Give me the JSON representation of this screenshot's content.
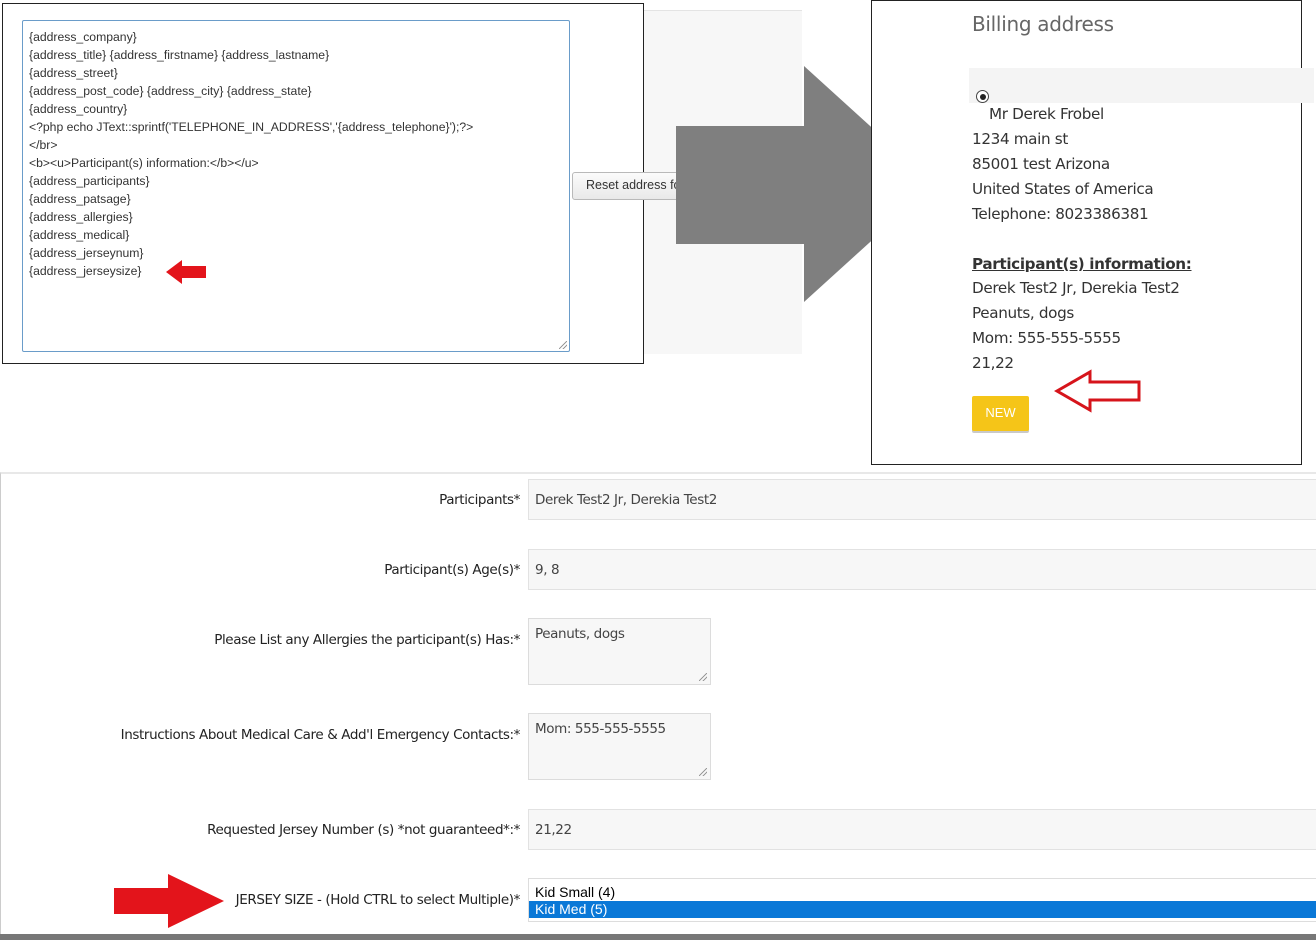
{
  "editor": {
    "template_lines": [
      "{address_company}",
      "{address_title} {address_firstname} {address_lastname}",
      "{address_street}",
      "{address_post_code} {address_city} {address_state}",
      "{address_country}",
      "<?php echo JText::sprintf('TELEPHONE_IN_ADDRESS','{address_telephone}');?>",
      "</br>",
      "<b><u>Participant(s) information:</b></u>",
      "{address_participants}",
      "{address_patsage}",
      "{address_allergies}",
      "{address_medical}",
      "{address_jerseynum}",
      "{address_jerseysize}"
    ],
    "reset_button_label": "Reset address fo"
  },
  "billing": {
    "title": "Billing address",
    "name": "Mr Derek Frobel",
    "street": "1234 main st",
    "city_line": "85001 test Arizona",
    "country": "United States of America",
    "telephone": "Telephone: 8023386381",
    "participants_heading": "Participant(s) information:",
    "participants": "Derek Test2 Jr, Derekia Test2",
    "allergies": "Peanuts, dogs",
    "medical": "Mom: 555-555-5555",
    "jersey_numbers": "21,22",
    "new_badge": "NEW"
  },
  "form": {
    "participants": {
      "label": "Participants*",
      "value": "Derek Test2 Jr, Derekia Test2"
    },
    "ages": {
      "label": "Participant(s) Age(s)*",
      "value": "9, 8"
    },
    "allergies": {
      "label": "Please List any Allergies the participant(s) Has:*",
      "value": "Peanuts, dogs"
    },
    "medical": {
      "label": "Instructions About Medical Care & Add'l Emergency Contacts:*",
      "value": "Mom: 555-555-5555"
    },
    "jersey_number": {
      "label": "Requested Jersey Number (s) *not guaranteed*:*",
      "value": "21,22"
    },
    "jersey_size": {
      "label": "JERSEY SIZE - (Hold CTRL to select Multiple)*",
      "options": [
        "Kid Small (4)",
        "Kid Med (5)"
      ],
      "selected": "Kid Med (5)"
    }
  },
  "colors": {
    "red_arrow": "#e3141b",
    "gray_arrow": "#7f7f7f",
    "new_badge": "#f5c518",
    "select_highlight": "#0a78d7"
  },
  "icons": [
    "radio-selected-icon",
    "red-arrow-icon",
    "gray-arrow-icon",
    "outline-arrow-icon",
    "resize-grip-icon"
  ]
}
